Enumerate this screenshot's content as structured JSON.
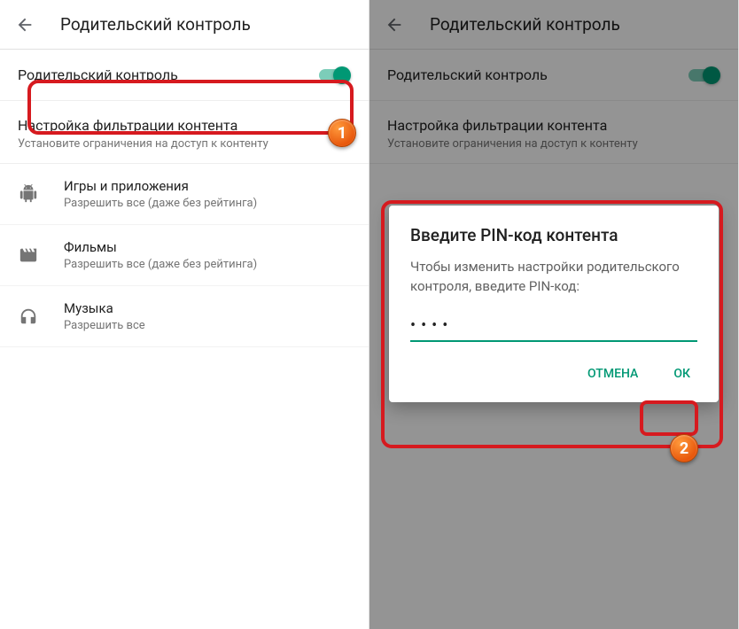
{
  "header": {
    "title": "Родительский контроль"
  },
  "toggle_row": {
    "label": "Родительский контроль"
  },
  "section": {
    "title": "Настройка фильтрации контента",
    "subtitle": "Установите ограничения на доступ к контенту"
  },
  "items": {
    "games": {
      "title": "Игры и приложения",
      "subtitle": "Разрешить все (даже без рейтинга)"
    },
    "movies": {
      "title": "Фильмы",
      "subtitle": "Разрешить все (даже без рейтинга)"
    },
    "music": {
      "title": "Музыка",
      "subtitle": "Разрешить все"
    }
  },
  "dialog": {
    "title": "Введите PIN-код контента",
    "body": "Чтобы изменить настройки родительского контроля, введите PIN-код:",
    "pin_masked": "••••",
    "cancel": "ОТМЕНА",
    "ok": "ОК"
  },
  "badges": {
    "one": "1",
    "two": "2"
  }
}
